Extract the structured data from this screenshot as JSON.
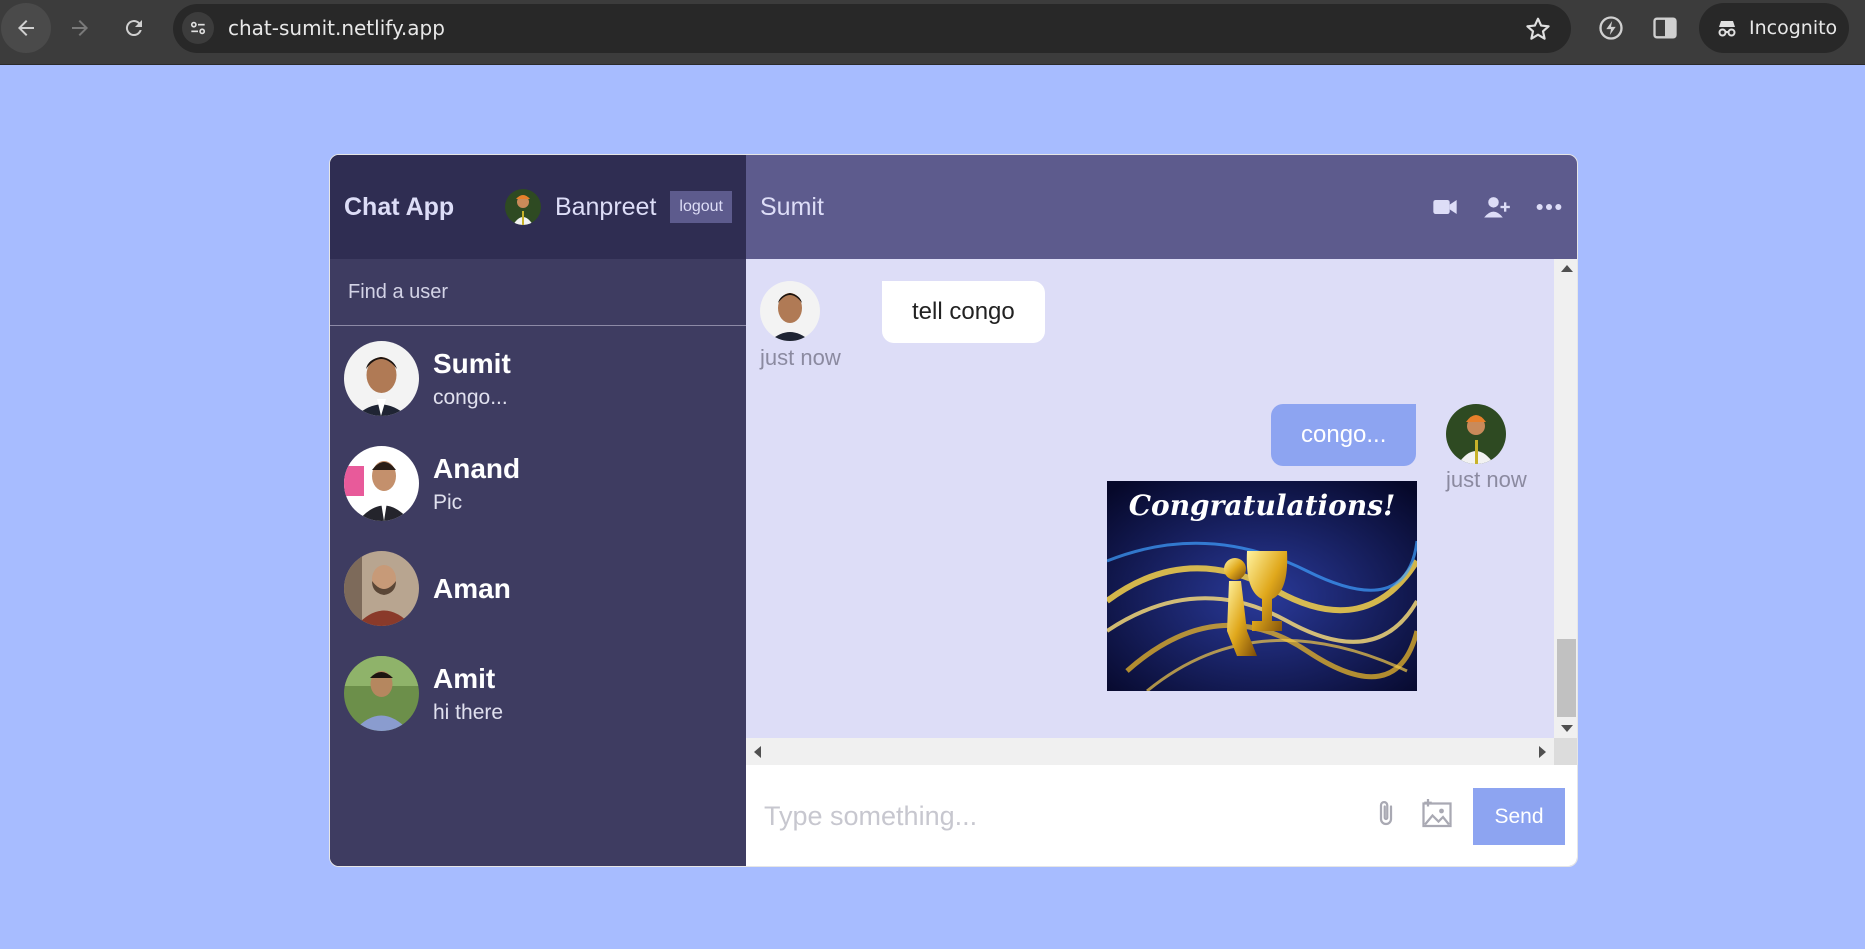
{
  "browser": {
    "url": "chat-sumit.netlify.app",
    "profile_label": "Incognito",
    "icons": [
      "back-arrow-icon",
      "forward-arrow-icon",
      "reload-icon",
      "site-settings-icon",
      "bookmark-star-icon",
      "performance-icon",
      "side-panel-icon",
      "incognito-icon"
    ]
  },
  "app": {
    "brand": "Chat App",
    "current_user": {
      "name": "Banpreet"
    },
    "logout_label": "logout",
    "search_placeholder": "Find a user",
    "chats": [
      {
        "name": "Sumit",
        "last_message": "congo..."
      },
      {
        "name": "Anand",
        "last_message": "Pic"
      },
      {
        "name": "Aman",
        "last_message": ""
      },
      {
        "name": "Amit",
        "last_message": "hi there"
      }
    ],
    "conversation": {
      "title": "Sumit",
      "header_icons": [
        "video-camera-icon",
        "add-user-icon",
        "more-icon"
      ],
      "messages": [
        {
          "from": "Sumit",
          "direction": "incoming",
          "text": "tell congo",
          "time": "just now"
        },
        {
          "from": "Banpreet",
          "direction": "outgoing",
          "text": "congo...",
          "time": "just now",
          "image_caption": "Congratulations!"
        }
      ]
    },
    "composer": {
      "placeholder": "Type something...",
      "send_label": "Send"
    }
  },
  "colors": {
    "page_bg": "#a7bcff",
    "sidebar_bg": "#3e3c61",
    "sidebar_topbar_bg": "#2f2d52",
    "chat_header_bg": "#5d5b8d",
    "chat_bg": "#ddddf7",
    "accent": "#8da4f1"
  }
}
